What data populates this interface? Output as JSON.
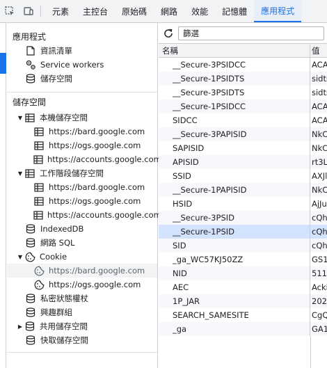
{
  "topbar": {
    "tabs": [
      "元素",
      "主控台",
      "原始碼",
      "網路",
      "效能",
      "記憶體",
      "應用程式"
    ],
    "active_tab": "應用程式"
  },
  "sidebar": {
    "app_section": "應用程式",
    "app_items": [
      "資訊清單",
      "Service workers",
      "儲存空間"
    ],
    "storage_section": "儲存空間",
    "local_storage": "本機儲存空間",
    "local_storage_items": [
      "https://bard.google.com",
      "https://ogs.google.com",
      "https://accounts.google.com"
    ],
    "session_storage": "工作階段儲存空間",
    "session_storage_items": [
      "https://bard.google.com",
      "https://ogs.google.com",
      "https://accounts.google.com"
    ],
    "indexeddb": "IndexedDB",
    "websql": "網路 SQL",
    "cookie": "Cookie",
    "cookie_items": [
      "https://bard.google.com",
      "https://ogs.google.com"
    ],
    "private_state_tokens": "私密狀態權杖",
    "interest_groups": "興趣群組",
    "shared_storage": "共用儲存空間",
    "cache_storage": "快取儲存空間"
  },
  "filter": {
    "value": "篩選"
  },
  "table": {
    "headers": [
      "名稱",
      "值"
    ],
    "rows": [
      [
        "__Secure-3PSIDCC",
        "ACA"
      ],
      [
        "__Secure-1PSIDTS",
        "sidts"
      ],
      [
        "__Secure-3PSIDTS",
        "sidts"
      ],
      [
        "__Secure-1PSIDCC",
        "ACA"
      ],
      [
        "SIDCC",
        "ACA"
      ],
      [
        "__Secure-3PAPISID",
        "NkC"
      ],
      [
        "SAPISID",
        "NkC"
      ],
      [
        "APISID",
        "rt3Ll"
      ],
      [
        "SSID",
        "AXJl"
      ],
      [
        "__Secure-1PAPISID",
        "NkC"
      ],
      [
        "HSID",
        "AjJu"
      ],
      [
        "__Secure-3PSID",
        "cQh"
      ],
      [
        "__Secure-1PSID",
        "cQh"
      ],
      [
        "SID",
        "cQh"
      ],
      [
        "_ga_WC57KJ50ZZ",
        "GS1."
      ],
      [
        "NID",
        "511="
      ],
      [
        "AEC",
        "Acki"
      ],
      [
        "1P_JAR",
        "2023"
      ],
      [
        "SEARCH_SAMESITE",
        "CgQ"
      ],
      [
        "_ga",
        "GA1."
      ]
    ],
    "selected_row": 12
  }
}
